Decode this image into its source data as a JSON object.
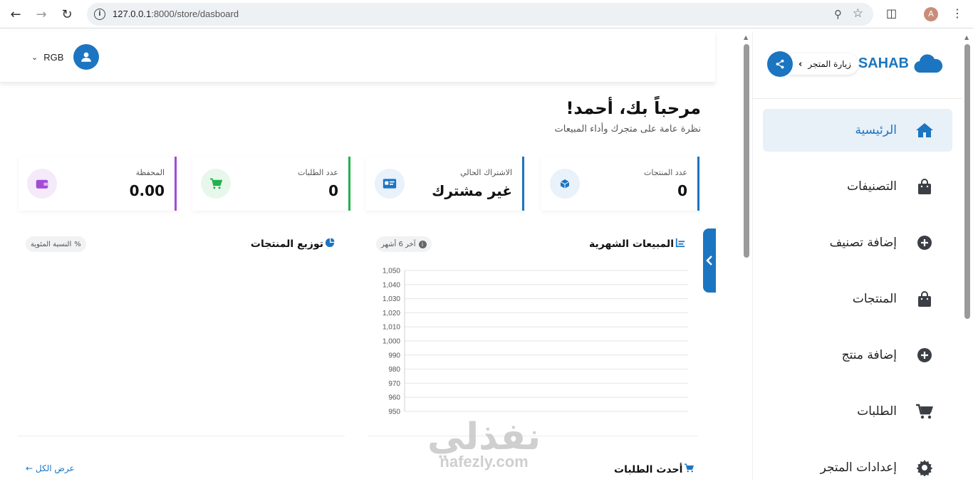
{
  "browser": {
    "url_host": "127.0.0.1",
    "url_rest": ":8000/store/dasboard",
    "profile_initial": "A"
  },
  "header": {
    "username": "RGB"
  },
  "welcome": {
    "title": "مرحباً بك، أحمد!",
    "subtitle": "نظرة عامة على متجرك وأداء المبيعات"
  },
  "stats": [
    {
      "label": "عدد المنتجات",
      "value": "0",
      "icon": "box-icon",
      "color": "#1c75c1"
    },
    {
      "label": "الاشتراك الحالي",
      "value": "غير مشترك",
      "icon": "id-card-icon",
      "color": "#1c75c1"
    },
    {
      "label": "عدد الطلبات",
      "value": "0",
      "icon": "cart-icon",
      "color": "#22b14c"
    },
    {
      "label": "المحفظة",
      "value": "0.00",
      "icon": "wallet-icon",
      "color": "#a24bd6"
    }
  ],
  "monthly_sales": {
    "title": "المبيعات الشهرية",
    "chip": "آخر 6 أشهر"
  },
  "distribution": {
    "title": "توزيع المنتجات",
    "chip": "النسبة المئوية"
  },
  "chart_data": {
    "type": "line",
    "title": "المبيعات الشهرية",
    "ylim": [
      950,
      1050
    ],
    "yticks": [
      "1,050",
      "1,040",
      "1,030",
      "1,020",
      "1,010",
      "1,000",
      "990",
      "980",
      "970",
      "960",
      "950"
    ],
    "series": []
  },
  "latest_orders": {
    "title": "أحدث الطلبات",
    "view_all": "عرض الكل"
  },
  "watermark": {
    "ar": "نفذلي",
    "en": "nafezly.com"
  },
  "sidebar": {
    "brand": "SAHAB",
    "visit_label": "زيارة المتجر",
    "items": [
      {
        "label": "الرئيسية",
        "icon": "home-icon",
        "active": true
      },
      {
        "label": "التصنيفات",
        "icon": "bag-icon"
      },
      {
        "label": "إضافة تصنيف",
        "icon": "plus-circle-icon"
      },
      {
        "label": "المنتجات",
        "icon": "bag-icon"
      },
      {
        "label": "إضافة منتج",
        "icon": "plus-circle-icon"
      },
      {
        "label": "الطلبات",
        "icon": "cart-icon"
      },
      {
        "label": "إعدادات المتجر",
        "icon": "gear-icon"
      }
    ]
  }
}
